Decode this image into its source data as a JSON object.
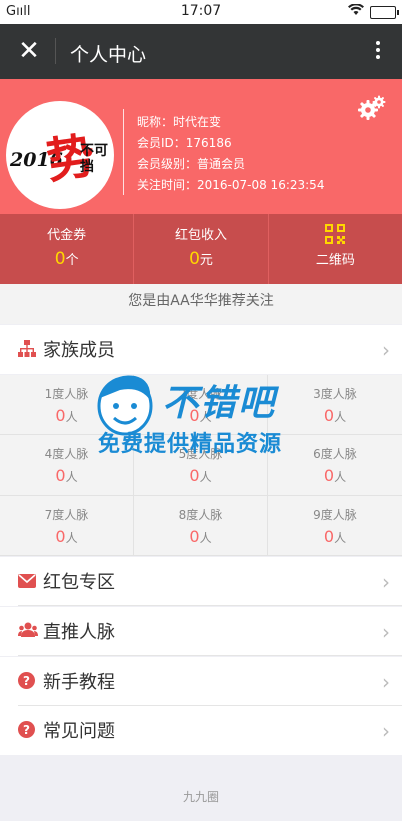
{
  "status_bar": {
    "carrier": "Gııll",
    "time": "17:07"
  },
  "nav": {
    "title": "个人中心"
  },
  "profile": {
    "avatar_text": {
      "year": "2016",
      "main": "势",
      "small": "不可挡"
    },
    "nickname": "昵称：时代在变",
    "member_id": "会员ID：176186",
    "level": "会员级别：普通会员",
    "follow_time": "关注时间：2016-07-08 16:23:54"
  },
  "stats": {
    "coupon": {
      "label": "代金券",
      "value": "0",
      "unit": "个"
    },
    "red_packet": {
      "label": "红包收入",
      "value": "0",
      "unit": "元"
    },
    "qrcode": {
      "label": "二维码"
    }
  },
  "referral": "您是由AA华华推荐关注",
  "family": {
    "title": "家族成员",
    "degrees": [
      {
        "label": "1度人脉",
        "value": "0",
        "unit": "人"
      },
      {
        "label": "2度人脉",
        "value": "0",
        "unit": "人"
      },
      {
        "label": "3度人脉",
        "value": "0",
        "unit": "人"
      },
      {
        "label": "4度人脉",
        "value": "0",
        "unit": "人"
      },
      {
        "label": "5度人脉",
        "value": "0",
        "unit": "人"
      },
      {
        "label": "6度人脉",
        "value": "0",
        "unit": "人"
      },
      {
        "label": "7度人脉",
        "value": "0",
        "unit": "人"
      },
      {
        "label": "8度人脉",
        "value": "0",
        "unit": "人"
      },
      {
        "label": "9度人脉",
        "value": "0",
        "unit": "人"
      }
    ]
  },
  "menu": {
    "red_packet_zone": "红包专区",
    "direct_referrals": "直推人脉",
    "tutorial": "新手教程",
    "faq": "常见问题"
  },
  "watermark": {
    "line1": "不错吧",
    "line2": "免费提供精品资源"
  },
  "footer": "九九圈",
  "colors": {
    "header": "#f96868",
    "stats_bar": "#c74d4d",
    "accent_yellow": "#ffd700",
    "nav": "#333536"
  }
}
